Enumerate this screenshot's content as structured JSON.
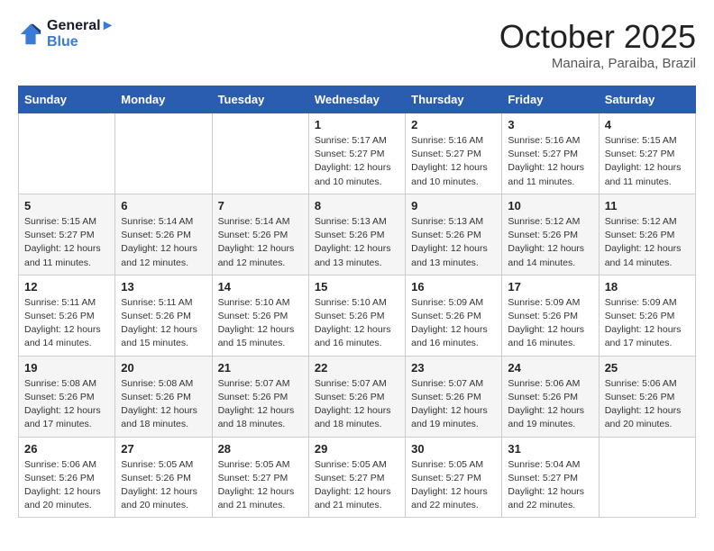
{
  "header": {
    "logo_line1": "General",
    "logo_line2": "Blue",
    "month": "October 2025",
    "location": "Manaira, Paraiba, Brazil"
  },
  "weekdays": [
    "Sunday",
    "Monday",
    "Tuesday",
    "Wednesday",
    "Thursday",
    "Friday",
    "Saturday"
  ],
  "weeks": [
    [
      {
        "day": "",
        "info": ""
      },
      {
        "day": "",
        "info": ""
      },
      {
        "day": "",
        "info": ""
      },
      {
        "day": "1",
        "info": "Sunrise: 5:17 AM\nSunset: 5:27 PM\nDaylight: 12 hours\nand 10 minutes."
      },
      {
        "day": "2",
        "info": "Sunrise: 5:16 AM\nSunset: 5:27 PM\nDaylight: 12 hours\nand 10 minutes."
      },
      {
        "day": "3",
        "info": "Sunrise: 5:16 AM\nSunset: 5:27 PM\nDaylight: 12 hours\nand 11 minutes."
      },
      {
        "day": "4",
        "info": "Sunrise: 5:15 AM\nSunset: 5:27 PM\nDaylight: 12 hours\nand 11 minutes."
      }
    ],
    [
      {
        "day": "5",
        "info": "Sunrise: 5:15 AM\nSunset: 5:27 PM\nDaylight: 12 hours\nand 11 minutes."
      },
      {
        "day": "6",
        "info": "Sunrise: 5:14 AM\nSunset: 5:26 PM\nDaylight: 12 hours\nand 12 minutes."
      },
      {
        "day": "7",
        "info": "Sunrise: 5:14 AM\nSunset: 5:26 PM\nDaylight: 12 hours\nand 12 minutes."
      },
      {
        "day": "8",
        "info": "Sunrise: 5:13 AM\nSunset: 5:26 PM\nDaylight: 12 hours\nand 13 minutes."
      },
      {
        "day": "9",
        "info": "Sunrise: 5:13 AM\nSunset: 5:26 PM\nDaylight: 12 hours\nand 13 minutes."
      },
      {
        "day": "10",
        "info": "Sunrise: 5:12 AM\nSunset: 5:26 PM\nDaylight: 12 hours\nand 14 minutes."
      },
      {
        "day": "11",
        "info": "Sunrise: 5:12 AM\nSunset: 5:26 PM\nDaylight: 12 hours\nand 14 minutes."
      }
    ],
    [
      {
        "day": "12",
        "info": "Sunrise: 5:11 AM\nSunset: 5:26 PM\nDaylight: 12 hours\nand 14 minutes."
      },
      {
        "day": "13",
        "info": "Sunrise: 5:11 AM\nSunset: 5:26 PM\nDaylight: 12 hours\nand 15 minutes."
      },
      {
        "day": "14",
        "info": "Sunrise: 5:10 AM\nSunset: 5:26 PM\nDaylight: 12 hours\nand 15 minutes."
      },
      {
        "day": "15",
        "info": "Sunrise: 5:10 AM\nSunset: 5:26 PM\nDaylight: 12 hours\nand 16 minutes."
      },
      {
        "day": "16",
        "info": "Sunrise: 5:09 AM\nSunset: 5:26 PM\nDaylight: 12 hours\nand 16 minutes."
      },
      {
        "day": "17",
        "info": "Sunrise: 5:09 AM\nSunset: 5:26 PM\nDaylight: 12 hours\nand 16 minutes."
      },
      {
        "day": "18",
        "info": "Sunrise: 5:09 AM\nSunset: 5:26 PM\nDaylight: 12 hours\nand 17 minutes."
      }
    ],
    [
      {
        "day": "19",
        "info": "Sunrise: 5:08 AM\nSunset: 5:26 PM\nDaylight: 12 hours\nand 17 minutes."
      },
      {
        "day": "20",
        "info": "Sunrise: 5:08 AM\nSunset: 5:26 PM\nDaylight: 12 hours\nand 18 minutes."
      },
      {
        "day": "21",
        "info": "Sunrise: 5:07 AM\nSunset: 5:26 PM\nDaylight: 12 hours\nand 18 minutes."
      },
      {
        "day": "22",
        "info": "Sunrise: 5:07 AM\nSunset: 5:26 PM\nDaylight: 12 hours\nand 18 minutes."
      },
      {
        "day": "23",
        "info": "Sunrise: 5:07 AM\nSunset: 5:26 PM\nDaylight: 12 hours\nand 19 minutes."
      },
      {
        "day": "24",
        "info": "Sunrise: 5:06 AM\nSunset: 5:26 PM\nDaylight: 12 hours\nand 19 minutes."
      },
      {
        "day": "25",
        "info": "Sunrise: 5:06 AM\nSunset: 5:26 PM\nDaylight: 12 hours\nand 20 minutes."
      }
    ],
    [
      {
        "day": "26",
        "info": "Sunrise: 5:06 AM\nSunset: 5:26 PM\nDaylight: 12 hours\nand 20 minutes."
      },
      {
        "day": "27",
        "info": "Sunrise: 5:05 AM\nSunset: 5:26 PM\nDaylight: 12 hours\nand 20 minutes."
      },
      {
        "day": "28",
        "info": "Sunrise: 5:05 AM\nSunset: 5:27 PM\nDaylight: 12 hours\nand 21 minutes."
      },
      {
        "day": "29",
        "info": "Sunrise: 5:05 AM\nSunset: 5:27 PM\nDaylight: 12 hours\nand 21 minutes."
      },
      {
        "day": "30",
        "info": "Sunrise: 5:05 AM\nSunset: 5:27 PM\nDaylight: 12 hours\nand 22 minutes."
      },
      {
        "day": "31",
        "info": "Sunrise: 5:04 AM\nSunset: 5:27 PM\nDaylight: 12 hours\nand 22 minutes."
      },
      {
        "day": "",
        "info": ""
      }
    ]
  ]
}
